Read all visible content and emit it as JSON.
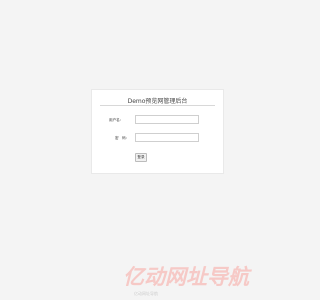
{
  "login": {
    "title": "Demo预览网管理后台",
    "username_label": "用户名:",
    "username_value": "",
    "password_label": "密　码:",
    "password_value": "",
    "submit_label": "登录"
  },
  "watermark": {
    "brand": "亿动网址导航",
    "sub": "亿动网址导航"
  },
  "colors": {
    "page_background": "#f4f4f4",
    "panel_background": "#ffffff",
    "watermark_color": "#f6c9c6"
  }
}
